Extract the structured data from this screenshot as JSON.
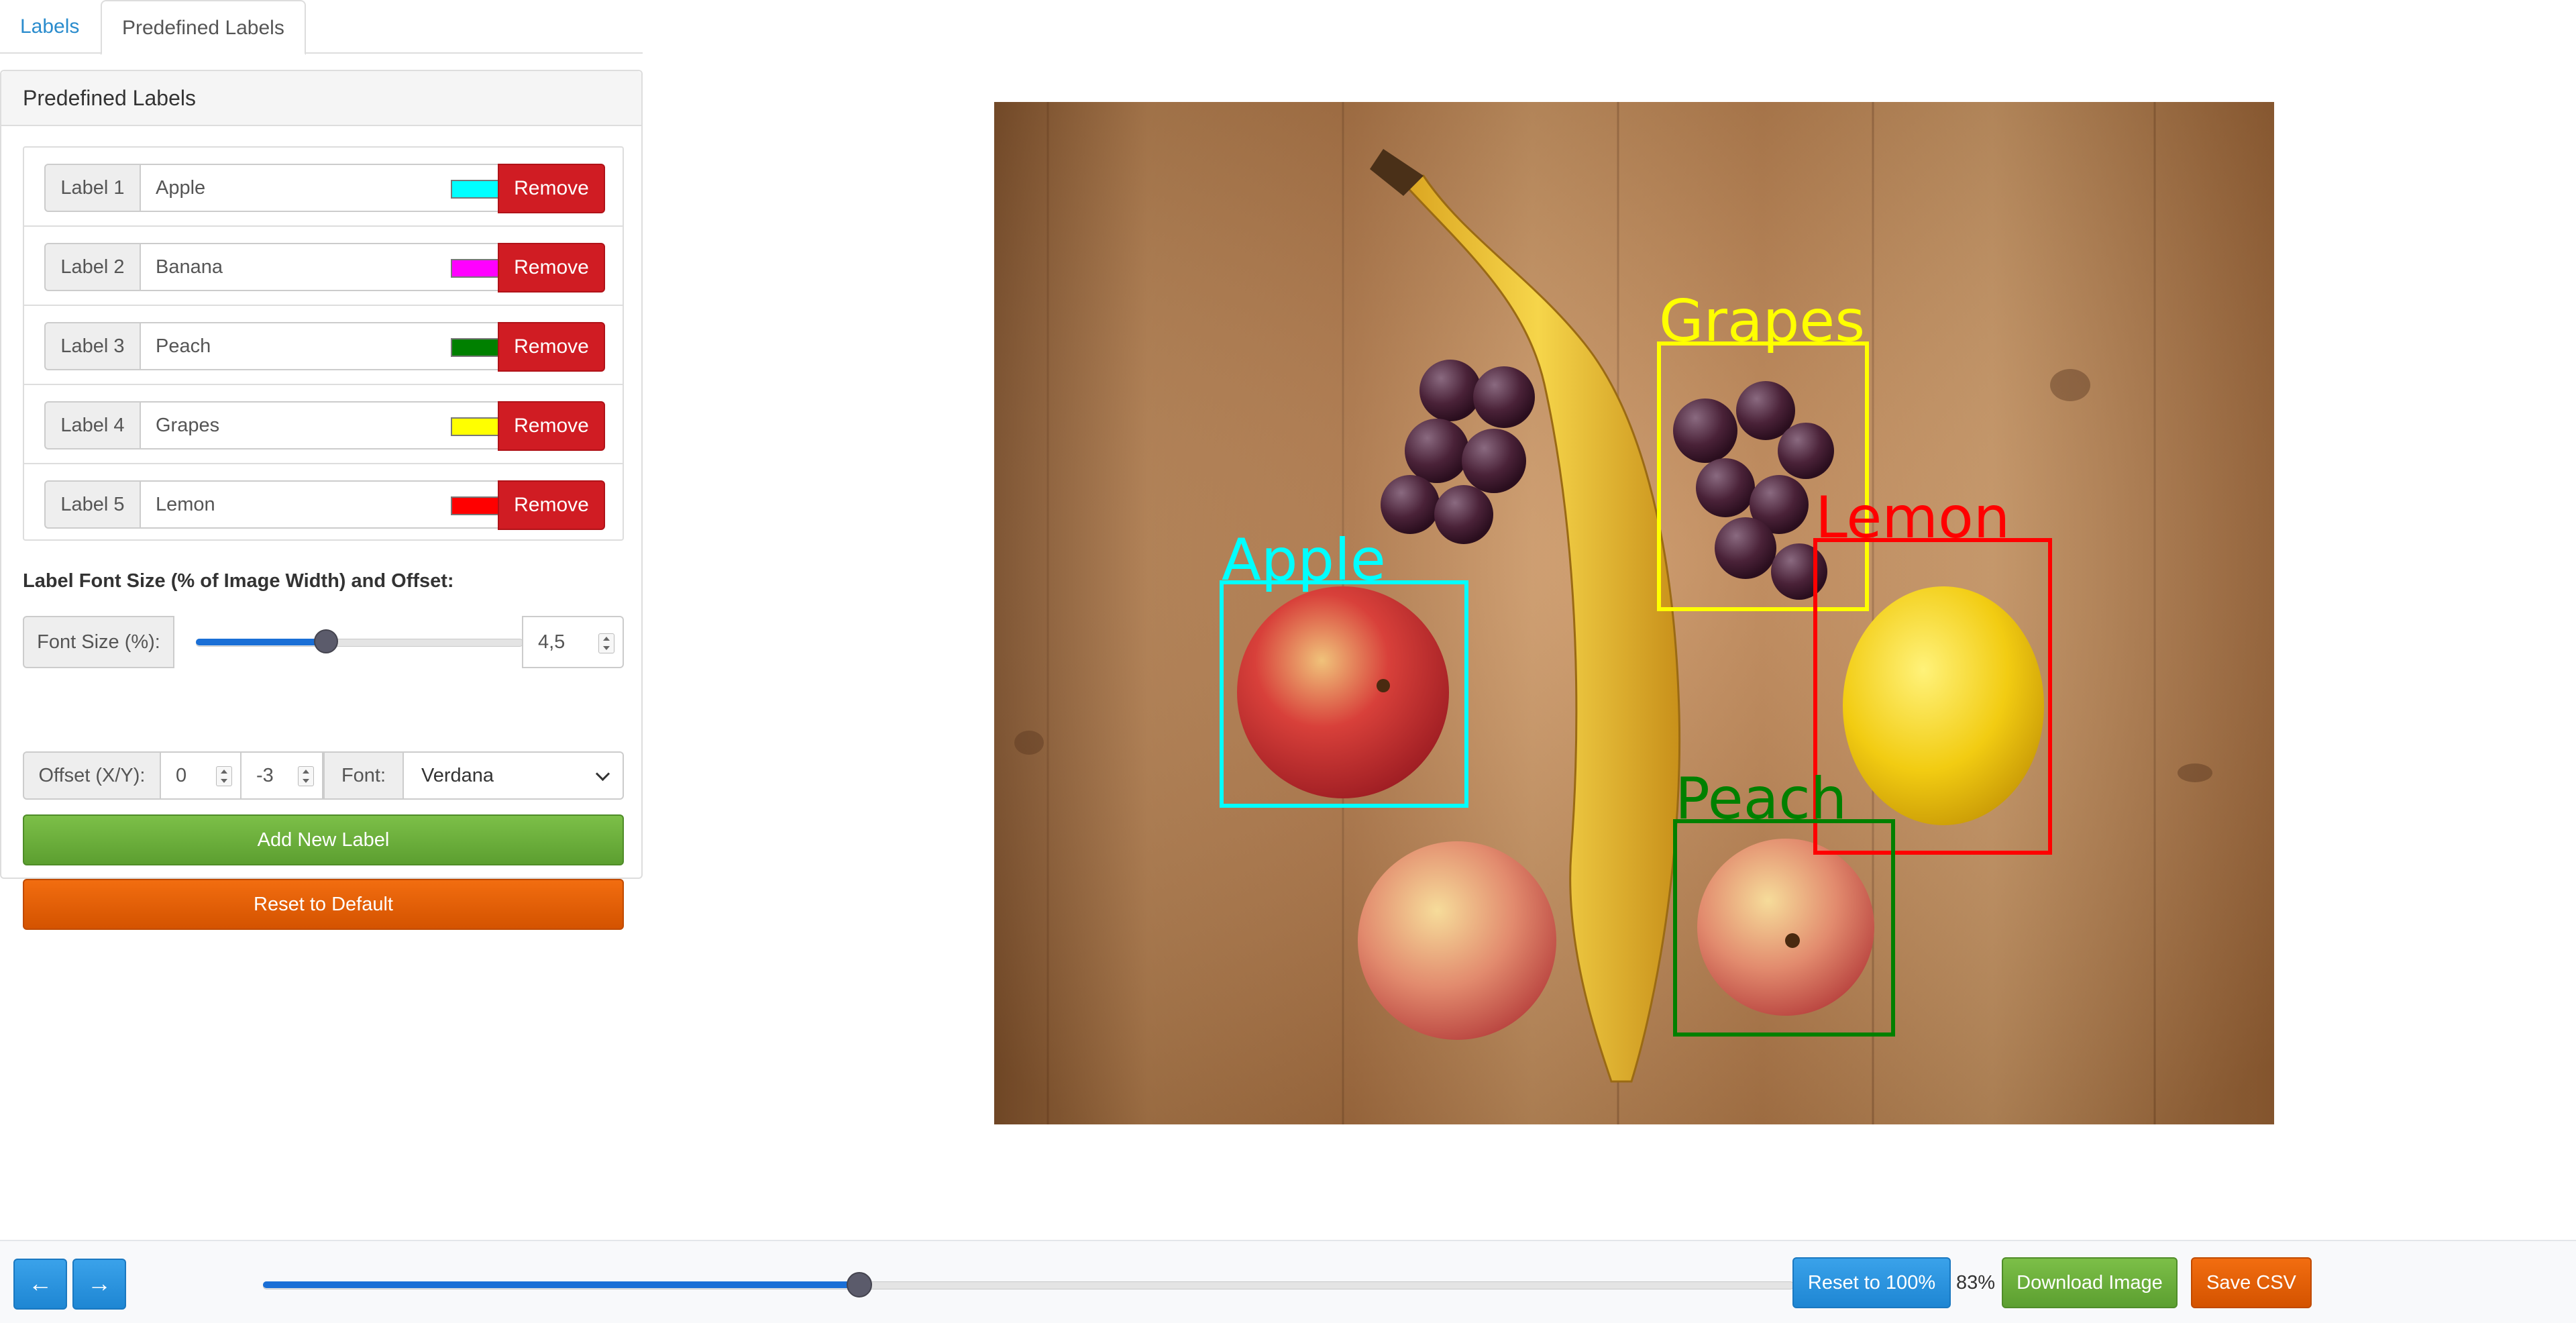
{
  "tabs": [
    {
      "label": "Labels",
      "active": false
    },
    {
      "label": "Predefined Labels",
      "active": true
    }
  ],
  "panel": {
    "title": "Predefined Labels",
    "labels": [
      {
        "addon": "Label 1",
        "value": "Apple",
        "color": "#00ffff",
        "remove": "Remove"
      },
      {
        "addon": "Label 2",
        "value": "Banana",
        "color": "#ff00ff",
        "remove": "Remove"
      },
      {
        "addon": "Label 3",
        "value": "Peach",
        "color": "#008000",
        "remove": "Remove"
      },
      {
        "addon": "Label 4",
        "value": "Grapes",
        "color": "#ffff00",
        "remove": "Remove"
      },
      {
        "addon": "Label 5",
        "value": "Lemon",
        "color": "#ff0000",
        "remove": "Remove"
      }
    ],
    "font_section_title": "Label Font Size (% of Image Width) and Offset:",
    "font_size_label": "Font Size (%):",
    "font_size_value": "4,5",
    "font_size_slider_fraction": 0.4,
    "offset_label": "Offset (X/Y):",
    "offset_x": "0",
    "offset_y": "-3",
    "font_label": "Font:",
    "font_value": "Verdana",
    "add_button": "Add New Label",
    "reset_button": "Reset to Default"
  },
  "image": {
    "annotations": [
      {
        "label": "Apple",
        "color": "#00ffff"
      },
      {
        "label": "Grapes",
        "color": "#ffff00"
      },
      {
        "label": "Lemon",
        "color": "#ff0000"
      },
      {
        "label": "Peach",
        "color": "#008000"
      }
    ]
  },
  "toolbar": {
    "prev_icon": "arrow-left-icon",
    "next_icon": "arrow-right-icon",
    "zoom_slider_fraction": 0.39,
    "reset_zoom": "Reset to 100%",
    "zoom_level": "83%",
    "download": "Download Image",
    "save_csv": "Save CSV"
  }
}
